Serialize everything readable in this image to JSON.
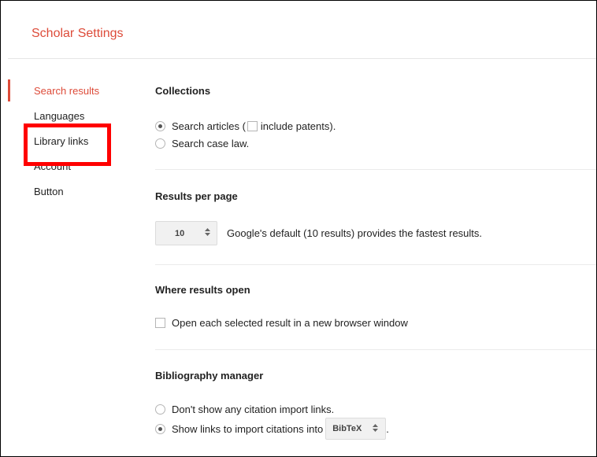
{
  "header": {
    "title": "Scholar Settings"
  },
  "sidebar": {
    "items": [
      {
        "label": "Search results",
        "active": true
      },
      {
        "label": "Languages"
      },
      {
        "label": "Library links"
      },
      {
        "label": "Account"
      },
      {
        "label": "Button"
      }
    ]
  },
  "collections": {
    "title": "Collections",
    "search_articles_prefix": "Search articles (",
    "include_patents": "include patents).",
    "search_case_law": "Search case law."
  },
  "results_per_page": {
    "title": "Results per page",
    "value": "10",
    "note": "Google's default (10 results) provides the fastest results."
  },
  "where_results_open": {
    "title": "Where results open",
    "new_window_label": "Open each selected result in a new browser window"
  },
  "bibliography": {
    "title": "Bibliography manager",
    "none_label": "Don't show any citation import links.",
    "show_label": "Show links to import citations into",
    "format": "BibTeX",
    "trailing": "."
  },
  "colors": {
    "accent": "#dd4b39",
    "highlight": "#ff0000"
  },
  "icons": {
    "select_arrows": "updown-arrows-icon"
  }
}
